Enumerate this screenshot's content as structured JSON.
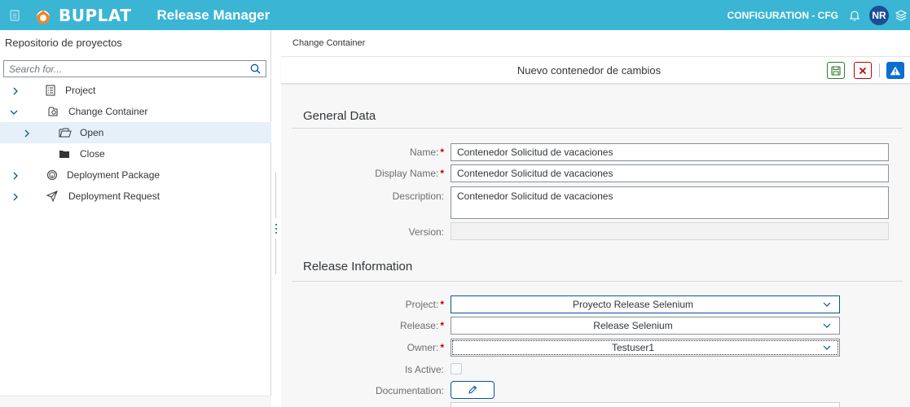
{
  "header": {
    "brand": "BUPLAT",
    "app_title": "Release Manager",
    "configuration": "CONFIGURATION - CFG",
    "avatar_initials": "NR",
    "bg_color": "#3ab5d4"
  },
  "left_pane": {
    "title": "Repositorio de proyectos",
    "search_placeholder": "Search for...",
    "tree": [
      {
        "label": "Project",
        "icon": "document-list-icon",
        "level": 0,
        "expanded": false
      },
      {
        "label": "Change Container",
        "icon": "container-icon",
        "level": 0,
        "expanded": true
      },
      {
        "label": "Open",
        "icon": "open-folder-icon",
        "level": 1,
        "expanded": false,
        "selected": true
      },
      {
        "label": "Close",
        "icon": "closed-folder-icon",
        "level": 1,
        "leaf": true
      },
      {
        "label": "Deployment Package",
        "icon": "package-icon",
        "level": 0,
        "expanded": false
      },
      {
        "label": "Deployment Request",
        "icon": "paper-plane-icon",
        "level": 0,
        "expanded": false
      }
    ]
  },
  "breadcrumb": "Change Container",
  "toolbar": {
    "title": "Nuevo contenedor de cambios",
    "buttons": [
      "save-icon",
      "close-icon",
      "warning-icon"
    ]
  },
  "general_data": {
    "title": "General Data",
    "name_label": "Name:",
    "name_value": "Contenedor Solicitud de vacaciones",
    "display_name_label": "Display Name:",
    "display_name_value": "Contenedor Solicitud de vacaciones",
    "description_label": "Description:",
    "description_value": "Contenedor Solicitud de vacaciones",
    "version_label": "Version:",
    "version_value": ""
  },
  "release_info": {
    "title": "Release Information",
    "project_label": "Project:",
    "project_value": "Proyecto Release Selenium",
    "release_label": "Release:",
    "release_value": "Release Selenium",
    "owner_label": "Owner:",
    "owner_value": "Testuser1",
    "is_active_label": "Is Active:",
    "is_active": false,
    "documentation_label": "Documentation:"
  },
  "required_mark": "*",
  "colors": {
    "required": "#bb0000",
    "save": "#2b7c2b",
    "cancel": "#bb0000",
    "warning_bg": "#0a6ed1",
    "selected_row": "#e5f0fa",
    "avatar_bg": "#1b4e94"
  }
}
